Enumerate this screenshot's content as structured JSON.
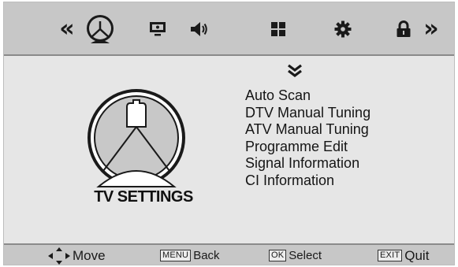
{
  "topbar": {
    "prev_glyph": "«",
    "next_glyph": "»",
    "tabs": [
      {
        "icon": "satellite-dish-icon",
        "active": true
      },
      {
        "icon": "picture-monitor-icon",
        "active": false
      },
      {
        "icon": "speaker-icon",
        "active": false
      },
      {
        "icon": "grid-icon",
        "active": false
      },
      {
        "icon": "gear-icon",
        "active": false
      },
      {
        "icon": "lock-icon",
        "active": false
      }
    ]
  },
  "main": {
    "section_title": "TV SETTINGS",
    "menu_items": [
      "Auto Scan",
      "DTV Manual Tuning",
      "ATV Manual Tuning",
      "Programme Edit",
      "Signal Information",
      "CI Information"
    ]
  },
  "footer": {
    "move_label": "Move",
    "back_key": "MENU",
    "back_label": "Back",
    "select_key": "OK",
    "select_label": "Select",
    "quit_key": "EXIT",
    "quit_label": "Quit"
  },
  "colors": {
    "bar_bg": "#c7c7c7",
    "panel_bg": "#e6e6e6",
    "text": "#1a1a1a",
    "icon_fill": "#1a1a1a",
    "dish_fill": "#c8c8c8"
  }
}
